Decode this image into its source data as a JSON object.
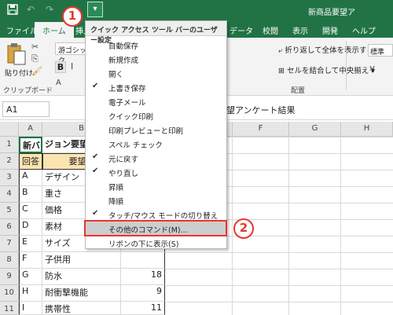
{
  "app": {
    "window_title": "新商品要望ア",
    "quick_access_button_label": "▾"
  },
  "callouts": [
    "1",
    "2"
  ],
  "ribbon": {
    "tabs": [
      {
        "label": "ファイル",
        "active": false
      },
      {
        "label": "ホーム",
        "active": true
      },
      {
        "label": "挿入",
        "active": false
      },
      {
        "label": "データ",
        "active": false
      },
      {
        "label": "校閲",
        "active": false
      },
      {
        "label": "表示",
        "active": false
      },
      {
        "label": "開発",
        "active": false
      },
      {
        "label": "ヘルプ",
        "active": false
      }
    ],
    "paste_label": "貼り付け",
    "clipboard_group": "クリップボード",
    "font_name": "游ゴシック",
    "bold": "B",
    "italic": "I",
    "font_color_glyph": "A",
    "wrap_text": "折り返して全体を表示する",
    "merge_center": "セルを結合して中央揃え",
    "alignment_group": "配置",
    "number_format": "標準"
  },
  "formula_bar": {
    "name_box": "A1",
    "formula": "望アンケート結果"
  },
  "columns": [
    "A",
    "B",
    "C",
    "D",
    "E",
    "F",
    "G",
    "H"
  ],
  "rows": [
    "1",
    "2",
    "3",
    "4",
    "5",
    "6",
    "7",
    "8",
    "9",
    "10",
    "11"
  ],
  "cells": {
    "row1": {
      "a": "新バー",
      "b": "ジョン要望"
    },
    "row2": {
      "a": "回答",
      "b": "要望内"
    },
    "data": [
      {
        "a": "A",
        "b": "デザイン",
        "c": ""
      },
      {
        "a": "B",
        "b": "重さ",
        "c": ""
      },
      {
        "a": "C",
        "b": "価格",
        "c": ""
      },
      {
        "a": "D",
        "b": "素材",
        "c": ""
      },
      {
        "a": "E",
        "b": "サイズ",
        "c": ""
      },
      {
        "a": "F",
        "b": "子供用",
        "c": ""
      },
      {
        "a": "G",
        "b": "防水",
        "c": "18"
      },
      {
        "a": "H",
        "b": "耐衝撃機能",
        "c": "9"
      },
      {
        "a": "I",
        "b": "携帯性",
        "c": "11"
      }
    ]
  },
  "menu": {
    "title": "クイック アクセス ツール バーのユーザー設定",
    "items": [
      {
        "label": "自動保存",
        "checked": false
      },
      {
        "label": "新規作成",
        "checked": false
      },
      {
        "label": "開く",
        "checked": false
      },
      {
        "label": "上書き保存",
        "checked": true
      },
      {
        "label": "電子メール",
        "checked": false
      },
      {
        "label": "クイック印刷",
        "checked": false
      },
      {
        "label": "印刷プレビューと印刷",
        "checked": false
      },
      {
        "label": "スペル チェック",
        "checked": false
      },
      {
        "label": "元に戻す",
        "checked": true
      },
      {
        "label": "やり直し",
        "checked": true
      },
      {
        "label": "昇順",
        "checked": false
      },
      {
        "label": "降順",
        "checked": false
      },
      {
        "label": "タッチ/マウス モードの切り替え",
        "checked": true
      },
      {
        "label": "その他のコマンド(M)...",
        "checked": false,
        "highlighted": true
      },
      {
        "label": "リボンの下に表示(S)",
        "checked": false
      }
    ]
  },
  "colors": {
    "excel_green": "#217346",
    "callout_red": "#e8362d",
    "header_fill": "#fce4b0"
  }
}
